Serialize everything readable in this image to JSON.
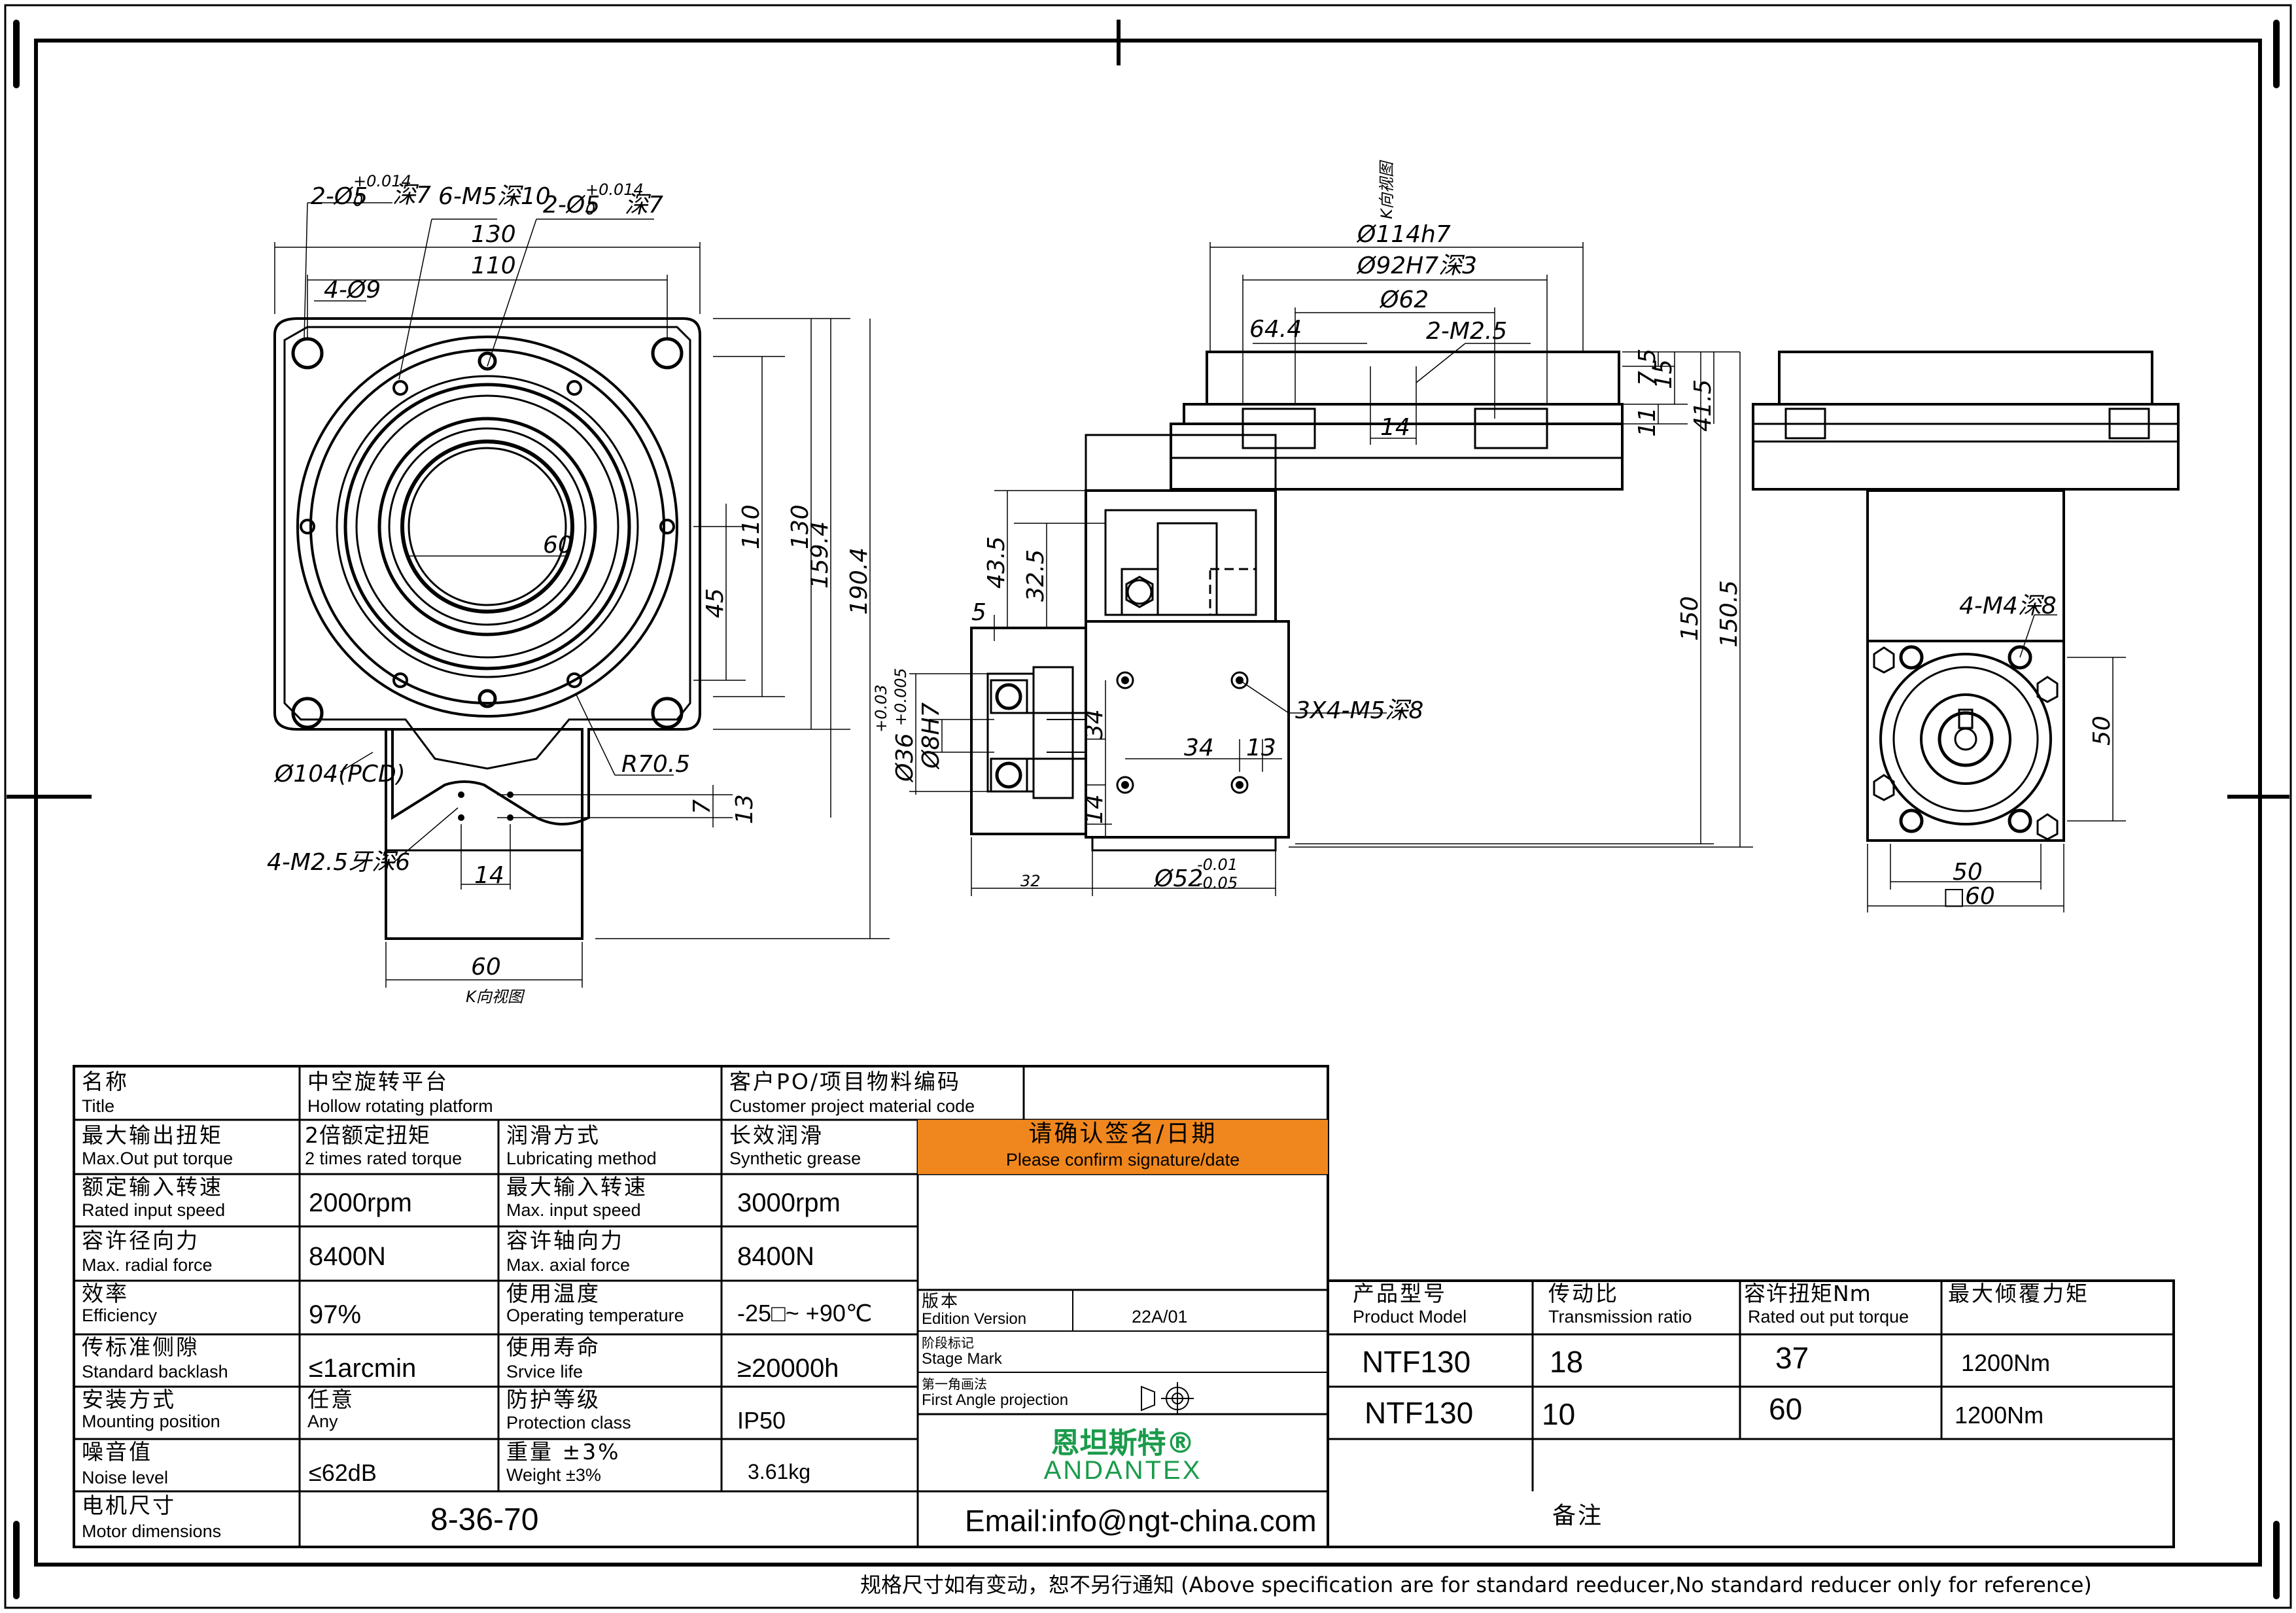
{
  "front_view": {
    "callouts": {
      "pin_left": "2-Ø5",
      "pin_right": "2-Ø5",
      "pin_tol_upper": "+0.014",
      "pin_tol_lower": "0",
      "pin_depth": "深7",
      "threads": "6-M5深10",
      "holes": "4-Ø9",
      "pcd": "Ø104(PCD)",
      "radius": "R70.5",
      "bottom_threads": "4-M2.5牙深6",
      "view_label": "K向视图"
    },
    "dims": {
      "w130": "130",
      "w110": "110",
      "d60": "60",
      "h45": "45",
      "h110": "110",
      "h130": "130",
      "h159": "159.4",
      "h190": "190.4",
      "v7": "7",
      "v13": "13",
      "b14": "14",
      "b60": "60"
    }
  },
  "side_view": {
    "dims": {
      "d114": "Ø114h7",
      "d92": "Ø92H7深3",
      "d62": "Ø62",
      "d644": "64.4",
      "pins": "2-M2.5",
      "v75": "7.5",
      "v15": "15",
      "v11": "11",
      "v415": "41.5",
      "h14": "14",
      "h435": "43.5",
      "h325": "32.5",
      "h5": "5",
      "d36": "Ø36",
      "d36_tol_upper": "+0.03",
      "d36_tol_lower": "+0.005",
      "d8": "Ø8H7",
      "v34": "34",
      "h34": "34",
      "h13": "13",
      "v14b": "14",
      "tap": "3X4-M5深8",
      "h32": "32",
      "d52": "Ø52",
      "d52_tol_upper": "-0.01",
      "d52_tol_lower": "-0.05",
      "h150": "150",
      "h1505": "150.5",
      "view_label": "K向视图"
    }
  },
  "right_view": {
    "dims": {
      "taps": "4-M4深8",
      "h50": "50",
      "w50": "50",
      "w60": "□60"
    }
  },
  "spec_table": {
    "rows": [
      {
        "c1_cn": "名称",
        "c1_en": "Title",
        "c2_cn": "中空旋转平台",
        "c2_en": "Hollow rotating platform",
        "c3_cn": "客户PO/项目物料编码",
        "c3_en": "Customer project material code"
      },
      {
        "c1_cn": "最大输出扭矩",
        "c1_en": "Max.Out put torque",
        "c2_cn": "2倍额定扭矩",
        "c2_en": "2 times rated torque",
        "c3_cn": "润滑方式",
        "c3_en": "Lubricating method",
        "c4_cn": "长效润滑",
        "c4_en": "Synthetic grease"
      },
      {
        "c1_cn": "额定输入转速",
        "c1_en": "Rated input speed",
        "c2_val": "2000rpm",
        "c3_cn": "最大输入转速",
        "c3_en": "Max. input speed",
        "c4_val": "3000rpm"
      },
      {
        "c1_cn": "容许径向力",
        "c1_en": "Max. radial force",
        "c2_val": "8400N",
        "c3_cn": "容许轴向力",
        "c3_en": "Max. axial force",
        "c4_val": "8400N"
      },
      {
        "c1_cn": "效率",
        "c1_en": "Efficiency",
        "c2_val": "97%",
        "c3_cn": "使用温度",
        "c3_en": "Operating temperature",
        "c4_val": "-25□~ +90℃"
      },
      {
        "c1_cn": "传标准侧隙",
        "c1_en": "Standard backlash",
        "c2_val": "≤1arcmin",
        "c3_cn": "使用寿命",
        "c3_en": "Srvice life",
        "c4_val": "≥20000h"
      },
      {
        "c1_cn": "安装方式",
        "c1_en": "Mounting position",
        "c2_cn": "任意",
        "c2_en": "Any",
        "c3_cn": "防护等级",
        "c3_en": "Protection class",
        "c4_val": "IP50"
      },
      {
        "c1_cn": "噪音值",
        "c1_en": "Noise level",
        "c2_val": "≤62dB",
        "c3_cn": "重量 ±3%",
        "c3_en": "Weight ±3%",
        "c4_val": "3.61kg"
      }
    ],
    "motor_cn": "电机尺寸",
    "motor_en": "Motor dimensions",
    "motor_val": "8-36-70"
  },
  "confirm": {
    "cn": "请确认签名/日期",
    "en": "Please confirm signature/date",
    "color": "#f0871e"
  },
  "version": {
    "edition_cn": "版本",
    "edition_en": "Edition Version",
    "edition_val": "22A/01",
    "stage_cn": "阶段标记",
    "stage_en": "Stage Mark",
    "proj_cn": "第一角画法",
    "proj_en": "First Angle projection"
  },
  "brand": {
    "cn": "恩坦斯特®",
    "en": "ANDANTEX",
    "color": "#1a9b4b"
  },
  "email": "Email:info@ngt-china.com",
  "remark": "备注",
  "model_table": {
    "headers": [
      {
        "cn": "产品型号",
        "en": "Product Model"
      },
      {
        "cn": "传动比",
        "en": "Transmission ratio"
      },
      {
        "cn": "容许扭矩Nm",
        "en": "Rated out put torque"
      },
      {
        "cn": "最大倾覆力矩",
        "en": ""
      }
    ],
    "rows": [
      {
        "model": "NTF130",
        "ratio": "18",
        "torque": "37",
        "moment": "1200Nm"
      },
      {
        "model": "NTF130",
        "ratio": "10",
        "torque": "60",
        "moment": "1200Nm"
      }
    ]
  },
  "footer": "规格尺寸如有变动，恕不另行通知  (Above specification are for standard reeducer,No standard reducer only for reference)"
}
